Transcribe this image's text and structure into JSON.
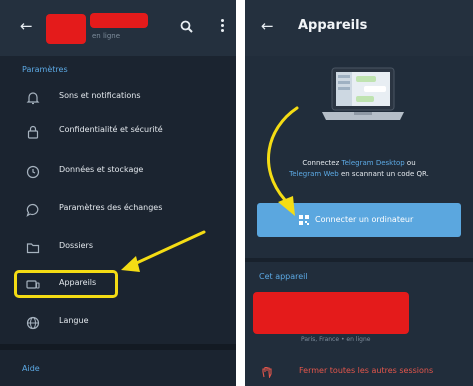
{
  "left_screen": {
    "header": {
      "back_icon": "arrow-left-icon",
      "status": "en ligne",
      "search_icon": "search-icon",
      "menu_icon": "more-vert-icon"
    },
    "settings_title": "Paramètres",
    "items": [
      {
        "label": "Sons et notifications",
        "icon": "bell-icon"
      },
      {
        "label": "Confidentialité et sécurité",
        "icon": "lock-icon"
      },
      {
        "label": "Données et stockage",
        "icon": "clock-icon"
      },
      {
        "label": "Paramètres des échanges",
        "icon": "chat-bubble-icon"
      },
      {
        "label": "Dossiers",
        "icon": "folder-icon"
      },
      {
        "label": "Appareils",
        "icon": "devices-icon"
      },
      {
        "label": "Langue",
        "icon": "globe-icon"
      }
    ],
    "help_title": "Aide"
  },
  "right_screen": {
    "header": {
      "back_icon": "arrow-left-icon",
      "title": "Appareils"
    },
    "description": {
      "part1": "Connectez",
      "link1": "Telegram Desktop",
      "part2": "ou",
      "link2": "Telegram Web",
      "part3": "en scannant un code QR."
    },
    "connect_button": {
      "label": "Connecter un ordinateur",
      "icon": "qr-code-icon"
    },
    "this_device_title": "Cet appareil",
    "device_status": "Paris, France • en ligne",
    "terminate_label": "Fermer toutes les autres sessions",
    "terminate_icon": "hand-stop-icon"
  },
  "colors": {
    "accent": "#5ca9e4",
    "highlight": "#f4dc14",
    "redaction": "#e41b1b",
    "danger": "#e5564b"
  }
}
